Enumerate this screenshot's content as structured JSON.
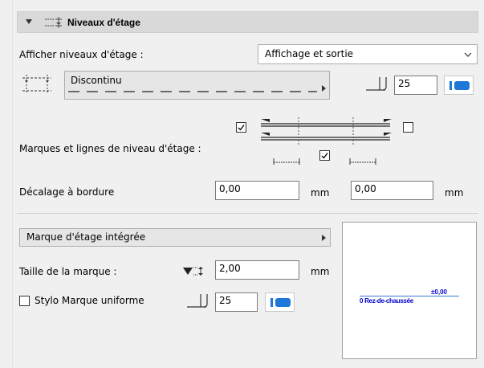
{
  "header": {
    "title": "Niveaux d'étage",
    "icon": "story-levels-icon",
    "collapse_icon": "triangle-down-icon"
  },
  "display": {
    "label": "Afficher niveaux d'étage :",
    "value": "Affichage et sortie",
    "icon": "chevron-down-icon"
  },
  "line_type": {
    "value": "Discontinu",
    "icon": "line-type-icon"
  },
  "pen": {
    "value": "25",
    "icon": "pen-icon"
  },
  "marks_lines": {
    "label": "Marques et lignes de niveau d'étage :",
    "left_checked": true,
    "right_checked": false,
    "center_checked": true
  },
  "offset": {
    "label": "Décalage à bordure",
    "value1": "0,00",
    "unit1": "mm",
    "value2": "0,00",
    "unit2": "mm"
  },
  "marker": {
    "dropdown_label": "Marque d'étage intégrée",
    "size_label": "Taille de la marque :",
    "size_value": "2,00",
    "size_unit": "mm",
    "uniform_pen_label": "Stylo Marque uniforme",
    "uniform_pen_checked": false,
    "pen_value": "25"
  },
  "preview": {
    "elevation": "±0,00",
    "story_name": "0 Rez-de-chaussée"
  },
  "colors": {
    "accent": "#1e78d7",
    "preview_text": "#0000cc",
    "preview_line": "#3a7bd5"
  }
}
